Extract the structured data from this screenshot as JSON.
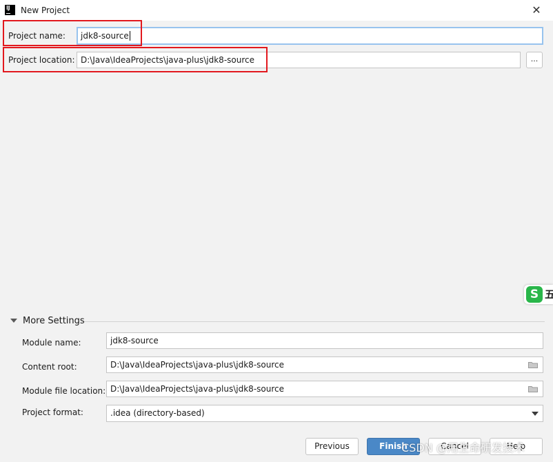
{
  "window": {
    "title": "New Project",
    "close_glyph": "✕"
  },
  "form": {
    "project_name": {
      "label": "Project name:",
      "value": "jdk8-source"
    },
    "project_location": {
      "label": "Project location:",
      "value": "D:\\Java\\IdeaProjects\\java-plus\\jdk8-source",
      "browse_label": "..."
    }
  },
  "more_settings": {
    "title": "More Settings",
    "expanded": true,
    "module_name": {
      "label": "Module name:",
      "value": "jdk8-source"
    },
    "content_root": {
      "label": "Content root:",
      "value": "D:\\Java\\IdeaProjects\\java-plus\\jdk8-source",
      "icon": "folder-icon"
    },
    "module_file_location": {
      "label": "Module file location:",
      "value": "D:\\Java\\IdeaProjects\\java-plus\\jdk8-source",
      "icon": "folder-icon"
    },
    "project_format": {
      "label": "Project format:",
      "value": ".idea (directory-based)"
    }
  },
  "buttons": {
    "previous": "Previous",
    "finish": "Finish",
    "cancel": "Cancel",
    "help": "Help"
  },
  "overlays": {
    "side_widget_icon": "sogou-ime-icon",
    "side_widget_letter": "S",
    "side_widget_char": "五",
    "watermark": "CSDN @用生命研发技术"
  },
  "colors": {
    "highlight_box": "#e2171d",
    "focus_border": "#97c3ee",
    "primary_button": "#4a88c7"
  }
}
